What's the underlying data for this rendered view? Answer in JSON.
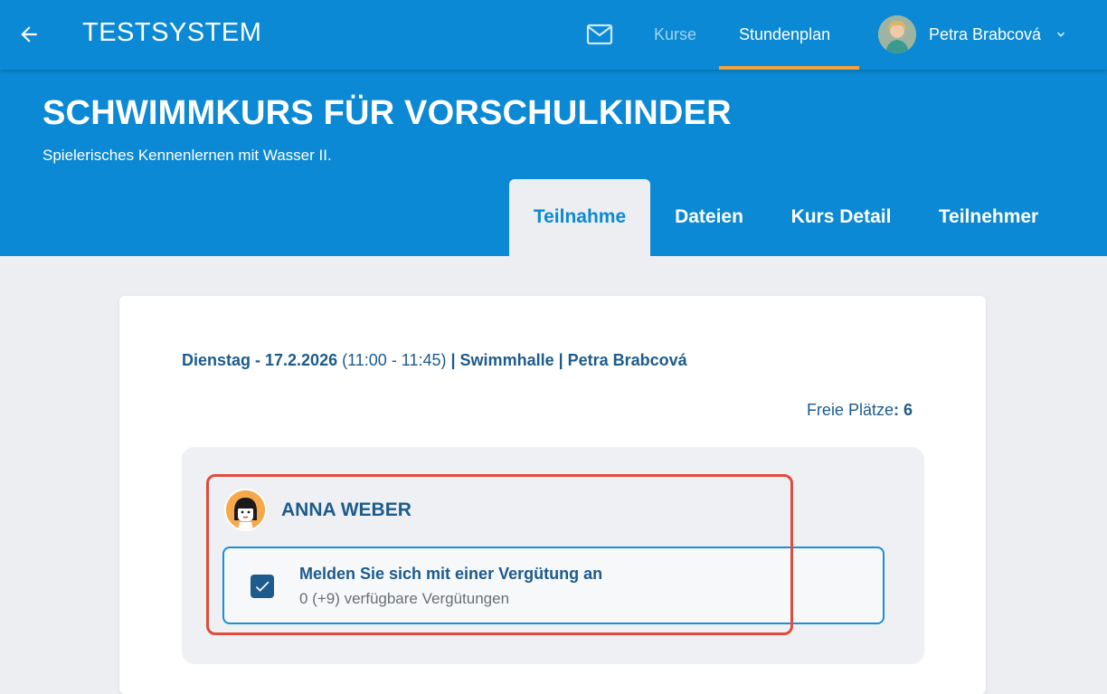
{
  "app": {
    "title": "TESTSYSTEM",
    "nav": {
      "kurse": "Kurse",
      "stundenplan": "Stundenplan"
    },
    "user": {
      "name": "Petra Brabcová"
    },
    "icons": {
      "back": "arrow-left-icon",
      "mail": "mail-icon",
      "chevron": "chevron-down-icon"
    },
    "colors": {
      "primary": "#0b89d4",
      "accent": "#f2a23a",
      "text_dark_blue": "#1d5b8c",
      "highlight": "#e14b3b"
    }
  },
  "course": {
    "title": "SCHWIMMKURS FÜR VORSCHULKINDER",
    "subtitle": "Spielerisches Kennenlernen mit Wasser II.",
    "tabs": [
      {
        "label": "Teilnahme",
        "active": true
      },
      {
        "label": "Dateien",
        "active": false
      },
      {
        "label": "Kurs Detail",
        "active": false
      },
      {
        "label": "Teilnehmer",
        "active": false
      }
    ]
  },
  "session": {
    "day_date": "Dienstag - 17.2.2026",
    "time": "(11:00 - 11:45)",
    "location_sep": " | Swimmhalle | Petra Brabcová",
    "free_places_label": "Freie Plätze",
    "free_places_colon": ": ",
    "free_places_value": "6"
  },
  "participant": {
    "name": "ANNA WEBER",
    "option": {
      "checked": true,
      "title": "Melden Sie sich mit einer Vergütung an",
      "subtitle": "0 (+9) verfügbare Vergütungen"
    }
  }
}
